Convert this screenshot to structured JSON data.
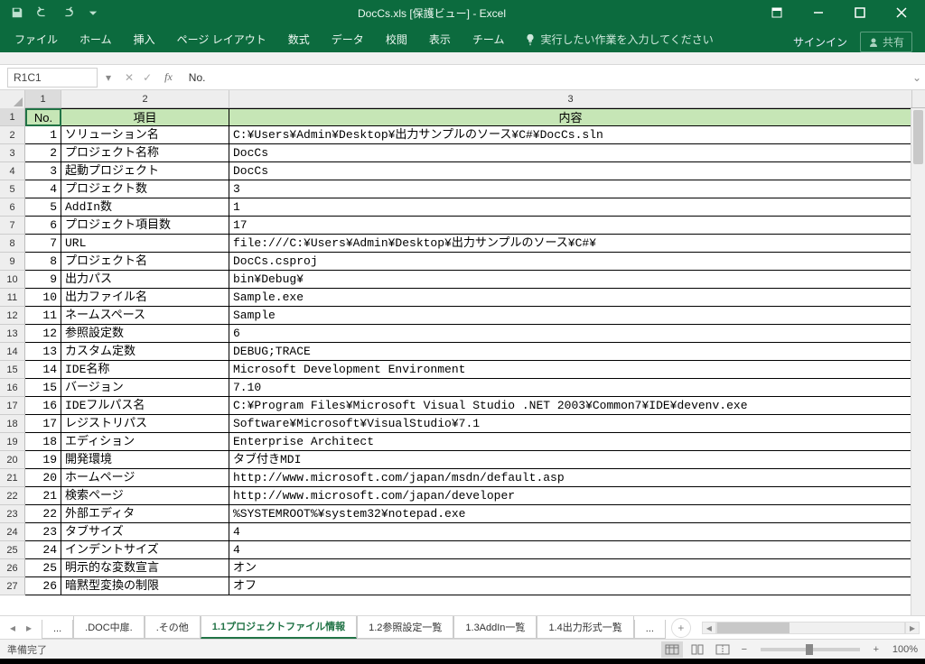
{
  "title": "DocCs.xls  [保護ビュー] - Excel",
  "ribbon": {
    "tabs": [
      "ファイル",
      "ホーム",
      "挿入",
      "ページ レイアウト",
      "数式",
      "データ",
      "校閲",
      "表示",
      "チーム"
    ],
    "tell_me": "実行したい作業を入力してください",
    "sign_in": "サインイン",
    "share": "共有"
  },
  "formula_bar": {
    "name_box": "R1C1",
    "formula": "No."
  },
  "columns": {
    "labels": [
      "1",
      "2",
      "3"
    ],
    "widths": [
      40,
      186,
      756
    ]
  },
  "header": {
    "no": "No.",
    "item": "項目",
    "content": "内容"
  },
  "rows": [
    {
      "no": 1,
      "item": "ソリューション名",
      "content": "C:¥Users¥Admin¥Desktop¥出力サンプルのソース¥C#¥DocCs.sln"
    },
    {
      "no": 2,
      "item": "プロジェクト名称",
      "content": "DocCs"
    },
    {
      "no": 3,
      "item": "起動プロジェクト",
      "content": "DocCs"
    },
    {
      "no": 4,
      "item": "プロジェクト数",
      "content": "3"
    },
    {
      "no": 5,
      "item": "AddIn数",
      "content": "1"
    },
    {
      "no": 6,
      "item": "プロジェクト項目数",
      "content": "17"
    },
    {
      "no": 7,
      "item": "URL",
      "content": "file:///C:¥Users¥Admin¥Desktop¥出力サンプルのソース¥C#¥"
    },
    {
      "no": 8,
      "item": "プロジェクト名",
      "content": "DocCs.csproj"
    },
    {
      "no": 9,
      "item": "出力パス",
      "content": "bin¥Debug¥"
    },
    {
      "no": 10,
      "item": "出力ファイル名",
      "content": "Sample.exe"
    },
    {
      "no": 11,
      "item": "ネームスペース",
      "content": "Sample"
    },
    {
      "no": 12,
      "item": "参照設定数",
      "content": "6"
    },
    {
      "no": 13,
      "item": "カスタム定数",
      "content": "DEBUG;TRACE"
    },
    {
      "no": 14,
      "item": "IDE名称",
      "content": "Microsoft Development Environment"
    },
    {
      "no": 15,
      "item": "バージョン",
      "content": "7.10"
    },
    {
      "no": 16,
      "item": "IDEフルパス名",
      "content": "C:¥Program Files¥Microsoft Visual Studio .NET 2003¥Common7¥IDE¥devenv.exe"
    },
    {
      "no": 17,
      "item": "レジストリパス",
      "content": "Software¥Microsoft¥VisualStudio¥7.1"
    },
    {
      "no": 18,
      "item": "エディション",
      "content": "Enterprise Architect"
    },
    {
      "no": 19,
      "item": "開発環境",
      "content": "タブ付きMDI"
    },
    {
      "no": 20,
      "item": "ホームページ",
      "content": "http://www.microsoft.com/japan/msdn/default.asp"
    },
    {
      "no": 21,
      "item": "検索ページ",
      "content": "http://www.microsoft.com/japan/developer"
    },
    {
      "no": 22,
      "item": "外部エディタ",
      "content": "%SYSTEMROOT%¥system32¥notepad.exe"
    },
    {
      "no": 23,
      "item": "タブサイズ",
      "content": "4"
    },
    {
      "no": 24,
      "item": "インデントサイズ",
      "content": "4"
    },
    {
      "no": 25,
      "item": "明示的な変数宣言",
      "content": "オン"
    },
    {
      "no": 26,
      "item": "暗黙型変換の制限",
      "content": "オフ"
    }
  ],
  "sheet_tabs": {
    "overflow": "...",
    "tabs": [
      ".DOC中扉.",
      ".その他",
      "1.1プロジェクトファイル情報",
      "1.2参照設定一覧",
      "1.3AddIn一覧",
      "1.4出力形式一覧"
    ],
    "active_index": 2,
    "more": "..."
  },
  "status": {
    "ready": "準備完了",
    "zoom": "100%"
  }
}
